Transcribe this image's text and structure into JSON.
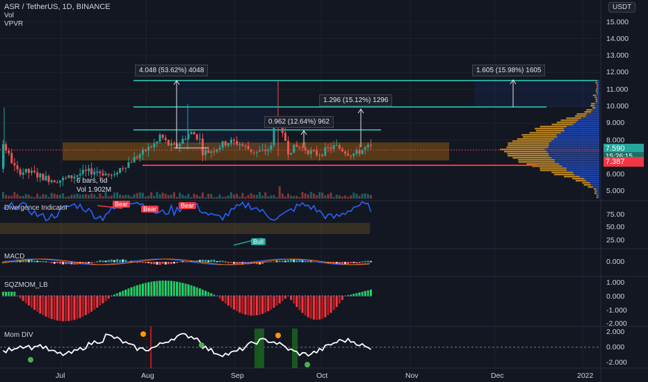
{
  "header": {
    "symbol_line": "ASR / TetherUS, 1D, BINANCE",
    "indicators": [
      "Vol",
      "VPVR"
    ],
    "currency_button": "USDT"
  },
  "price_axis": {
    "labels": [
      "15.000",
      "14.000",
      "13.000",
      "12.000",
      "11.000",
      "10.000",
      "9.000",
      "8.000",
      "6.000",
      "5.000"
    ],
    "current_price": "7.590",
    "countdown": "15:26:15",
    "red_tag": "7.387"
  },
  "pane_labels": {
    "divergence": "Divergence Indicator",
    "macd": "MACD",
    "sqzmom": "SQZMOM_LB",
    "momdiv": "Mom DIV"
  },
  "divergence_axis": [
    "75.00",
    "50.00",
    "25.00"
  ],
  "macd_axis": [
    "0.000"
  ],
  "sqz_axis": [
    "1.000",
    "0.000",
    "-1.000",
    "-2.000"
  ],
  "mom_axis": [
    "2.000",
    "0.000",
    "-2.000"
  ],
  "time_axis": [
    "Jul",
    "Aug",
    "Sep",
    "Oct",
    "Nov",
    "Dec"
  ],
  "year_label": "2022",
  "measurements": [
    "4.048 (53.62%) 4048",
    "1.605 (15.98%) 1605",
    "1.296 (15.12%) 1296",
    "0.962 (12.64%) 962",
    "6 bars, 6d",
    "Vol 1.902M"
  ],
  "signals": {
    "bear": "Bear",
    "bull": "Bull"
  },
  "colors": {
    "background": "#131722",
    "bull_candle": "#26a69a",
    "bear_candle": "#ef5350",
    "teal_line": "#26a69a",
    "red_line": "#f23645",
    "zone": "#ff9800",
    "divergence_line": "#2962ff",
    "mom_line": "#ffffff"
  }
}
